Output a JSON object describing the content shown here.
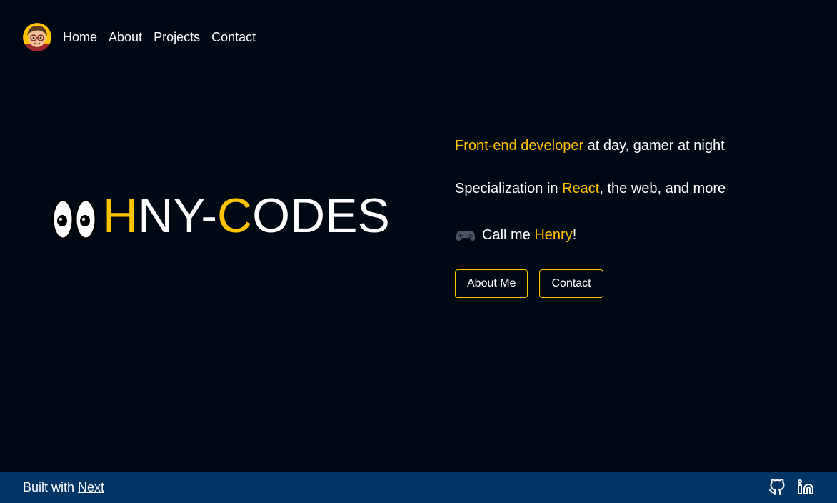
{
  "nav": {
    "avatar_icon": "avatar-cartoon-face",
    "links": [
      "Home",
      "About",
      "Projects",
      "Contact"
    ]
  },
  "logo": {
    "icon": "googly-eyes-icon",
    "part1_accent": "H",
    "part1_rest": "NY-",
    "part2_accent": "C",
    "part2_rest": "ODES"
  },
  "intro": {
    "line1_accent": "Front-end developer",
    "line1_rest": " at day, gamer at night",
    "line2_pre": "Specialization in ",
    "line2_accent": "React",
    "line2_post": ", the web, and more",
    "line3_icon": "gamepad-icon",
    "line3_pre": "Call me ",
    "line3_accent": "Henry",
    "line3_post": "!"
  },
  "buttons": {
    "about": "About Me",
    "contact": "Contact"
  },
  "footer": {
    "built_with": "Built with ",
    "link": "Next",
    "icons": [
      "github-icon",
      "linkedin-icon"
    ]
  },
  "colors": {
    "background": "#000814",
    "accent": "#ffc300",
    "footer": "#003566",
    "text": "#ffffff"
  }
}
